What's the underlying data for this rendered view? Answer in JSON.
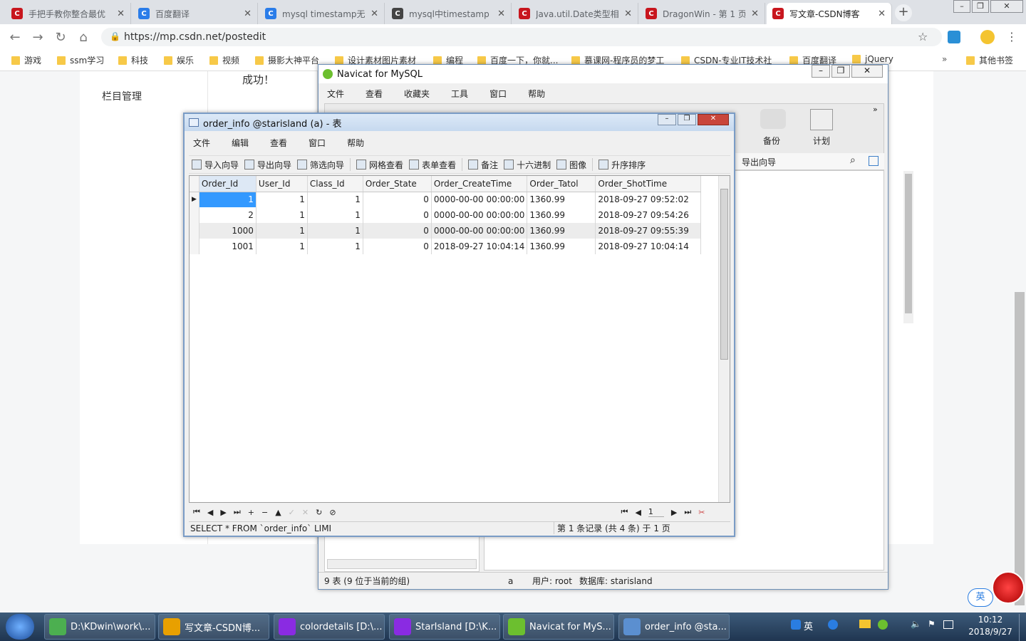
{
  "browser": {
    "tabs": [
      {
        "label": "手把手教你整合最优",
        "icon": "csdn-icon",
        "color": "#c8161e"
      },
      {
        "label": "百度翻译",
        "icon": "translate-icon",
        "color": "#2b7de9"
      },
      {
        "label": "mysql timestamp无",
        "icon": "baidu-paw-icon",
        "color": "#2b7de9"
      },
      {
        "label": "mysql中timestamp",
        "icon": "github-icon",
        "color": "#444444"
      },
      {
        "label": "Java.util.Date类型相",
        "icon": "csdn-icon",
        "color": "#c8161e"
      },
      {
        "label": "DragonWin - 第 1 页",
        "icon": "csdn-icon",
        "color": "#c8161e"
      },
      {
        "label": "写文章-CSDN博客",
        "icon": "csdn-icon",
        "color": "#c8161e"
      }
    ],
    "url": "https://mp.csdn.net/postedit",
    "bookmarks": [
      "游戏",
      "ssm学习",
      "科技",
      "娱乐",
      "视频",
      "摄影大神平台",
      "设计素材图片素材",
      "编程",
      "百度一下，你就...",
      "慕课网-程序员的梦工",
      "CSDN-专业IT技术社",
      "百度翻译",
      "jQuery"
    ],
    "more_bookmarks": "其他书签"
  },
  "page": {
    "sidebar_item": "栏目管理",
    "success_text": "成功！"
  },
  "navicat": {
    "title": "Navicat for MySQL",
    "menu": [
      "文件",
      "查看",
      "收藏夹",
      "工具",
      "窗口",
      "帮助"
    ],
    "toolbar_right": [
      "备份",
      "计划"
    ],
    "export_wizard": "导出向导",
    "status_tables": "9 表 (9 位于当前的组)",
    "status_conn": "a",
    "status_user": "用户: root",
    "status_db": "数据库: starisland"
  },
  "table_window": {
    "title": "order_info @starisland (a) - 表",
    "menu": [
      "文件",
      "编辑",
      "查看",
      "窗口",
      "帮助"
    ],
    "toolbar": [
      "导入向导",
      "导出向导",
      "筛选向导",
      "网格查看",
      "表单查看",
      "备注",
      "十六进制",
      "图像",
      "升序排序"
    ],
    "columns": [
      "Order_Id",
      "User_Id",
      "Class_Id",
      "Order_State",
      "Order_CreateTime",
      "Order_Tatol",
      "Order_ShotTime"
    ],
    "rows": [
      [
        "1",
        "1",
        "1",
        "0",
        "0000-00-00 00:00:00",
        "1360.99",
        "2018-09-27 09:52:02"
      ],
      [
        "2",
        "1",
        "1",
        "0",
        "0000-00-00 00:00:00",
        "1360.99",
        "2018-09-27 09:54:26"
      ],
      [
        "1000",
        "1",
        "1",
        "0",
        "0000-00-00 00:00:00",
        "1360.99",
        "2018-09-27 09:55:39"
      ],
      [
        "1001",
        "1",
        "1",
        "0",
        "2018-09-27 10:04:14",
        "1360.99",
        "2018-09-27 10:04:14"
      ]
    ],
    "page_number": "1",
    "sql": "SELECT * FROM `order_info` LIMI",
    "record_info": "第 1 条记录 (共 4 条) 于 1 页"
  },
  "taskbar": {
    "items": [
      {
        "label": "D:\\KDwin\\work\\...",
        "color": "#4caf50"
      },
      {
        "label": "写文章-CSDN博...",
        "color": "#e8a000"
      },
      {
        "label": "colordetails [D:\\...",
        "color": "#8a2be2"
      },
      {
        "label": "StarIsland [D:\\K...",
        "color": "#8a2be2"
      },
      {
        "label": "Navicat for MyS...",
        "color": "#6cbf2f"
      },
      {
        "label": "order_info @sta...",
        "color": "#5b8fd0"
      }
    ],
    "ime": "英",
    "time": "10:12",
    "date": "2018/9/27"
  },
  "ime_float": "英"
}
